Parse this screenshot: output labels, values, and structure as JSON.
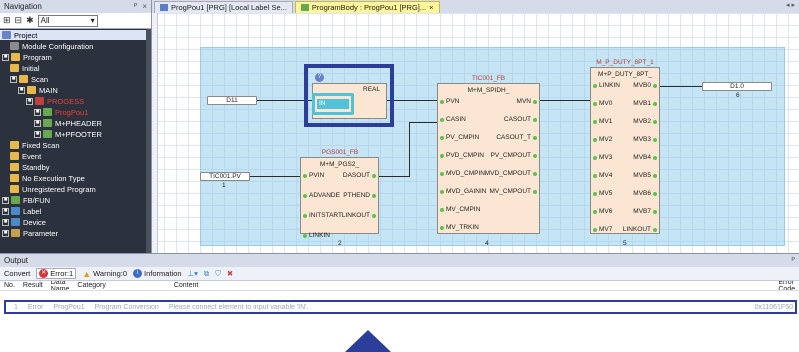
{
  "nav": {
    "title": "Navigation",
    "pin": "ᴾ",
    "close": "×",
    "filter": "All"
  },
  "tree": [
    {
      "label": "Project",
      "level": 0,
      "sel": true,
      "icon": "#6a82c8"
    },
    {
      "label": "Module Configuration",
      "level": 1,
      "icon": "#8c8c8c"
    },
    {
      "label": "Program",
      "level": 0,
      "ex": "■",
      "icon": "#e8b84a"
    },
    {
      "label": "Initial",
      "level": 1,
      "icon": "#e8b84a"
    },
    {
      "label": "Scan",
      "level": 1,
      "ex": "■",
      "icon": "#e8b84a"
    },
    {
      "label": "MAIN",
      "level": 2,
      "ex": "■",
      "icon": "#e8b84a"
    },
    {
      "label": "PROGESS",
      "level": 3,
      "ex": "■",
      "icon": "#c04040",
      "red": true
    },
    {
      "label": "ProgPou1",
      "level": 4,
      "ex": "■",
      "icon": "#6aa84f",
      "red": true
    },
    {
      "label": "M+PHEADER",
      "level": 4,
      "ex": "■",
      "icon": "#6aa84f"
    },
    {
      "label": "M+PFOOTER",
      "level": 4,
      "ex": "■",
      "icon": "#6aa84f"
    },
    {
      "label": "Fixed Scan",
      "level": 1,
      "icon": "#e8b84a"
    },
    {
      "label": "Event",
      "level": 1,
      "icon": "#e8b84a"
    },
    {
      "label": "Standby",
      "level": 1,
      "icon": "#e8b84a"
    },
    {
      "label": "No Execution Type",
      "level": 1,
      "icon": "#e8b84a"
    },
    {
      "label": "Unregistered Program",
      "level": 1,
      "icon": "#e8b84a"
    },
    {
      "label": "FB/FUN",
      "level": 0,
      "ex": "■",
      "icon": "#6aa84f"
    },
    {
      "label": "Label",
      "level": 0,
      "ex": "■",
      "icon": "#4a8ac8"
    },
    {
      "label": "Device",
      "level": 0,
      "ex": "■",
      "icon": "#4a8ac8"
    },
    {
      "label": "Parameter",
      "level": 0,
      "ex": "■",
      "icon": "#c8a04a"
    }
  ],
  "tabs": [
    {
      "label": "ProgPou1 [PRG] [Local Label Se..."
    },
    {
      "label": "ProgramBody : ProgPou1 [PRG]...",
      "active": true,
      "close": "×"
    }
  ],
  "tabscroll": "◂ ▸",
  "ladder": {
    "in_d11": "D11",
    "in_tic": "TIC001.PV",
    "in_tic_num": "1",
    "out_d10": "D1.0",
    "out_d10_num": "6",
    "fb1": {
      "title": "PGS001_FB",
      "type": "M+M_PGS2_",
      "num": "2",
      "pins_l": [
        "PVIN",
        "ADVANDE",
        "INITSTART",
        "LINKIN"
      ],
      "pins_r": [
        "DASOUT",
        "PTHEND",
        "LINKOUT"
      ]
    },
    "fb2": {
      "title": "TIC001_FB",
      "type": "M+M_SPIDH_",
      "num": "4",
      "pins_l": [
        "PVN",
        "CASIN",
        "PV_CMPIN",
        "PVD_CMPIN",
        "MVD_CMPIN",
        "MVD_GAININ",
        "MV_CMPIN",
        "MV_TRKIN"
      ],
      "pins_r": [
        "MVN",
        "CASOUT",
        "CASOUT_T",
        "PV_CMPOUT",
        "MVD_CMPOUT",
        "MV_CMPOUT"
      ]
    },
    "fb3": {
      "title": "M_P_DUTY_8PT_1",
      "type": "M+P_DUTY_8PT_",
      "num": "5",
      "pins_l": [
        "LINKIN",
        "MV0",
        "MV1",
        "MV2",
        "MV3",
        "MV4",
        "MV5",
        "MV6",
        "MV7"
      ],
      "pins_r": [
        "MVB0",
        "MVB1",
        "MVB2",
        "MVB3",
        "MVB4",
        "MVB5",
        "MVB6",
        "MVB7",
        "LINKOUT"
      ]
    },
    "fb4": {
      "title": "",
      "type": "REAL",
      "pin": "IN",
      "badge": "?"
    }
  },
  "output": {
    "title": "Output",
    "pin": "ᴾ",
    "toolbar": {
      "convert": "Convert",
      "error": "Error:1",
      "warning": "Warning:0",
      "info": "Information"
    },
    "cols": [
      "No.",
      "Result",
      "Data Name",
      "Category",
      "Content",
      "Error Code"
    ],
    "row": {
      "no": "1",
      "result": "Error",
      "data": "ProgPou1",
      "category": "Program Conversion",
      "content": "Please connect element to input variable 'IN'.",
      "code": "0x11061F50"
    }
  }
}
